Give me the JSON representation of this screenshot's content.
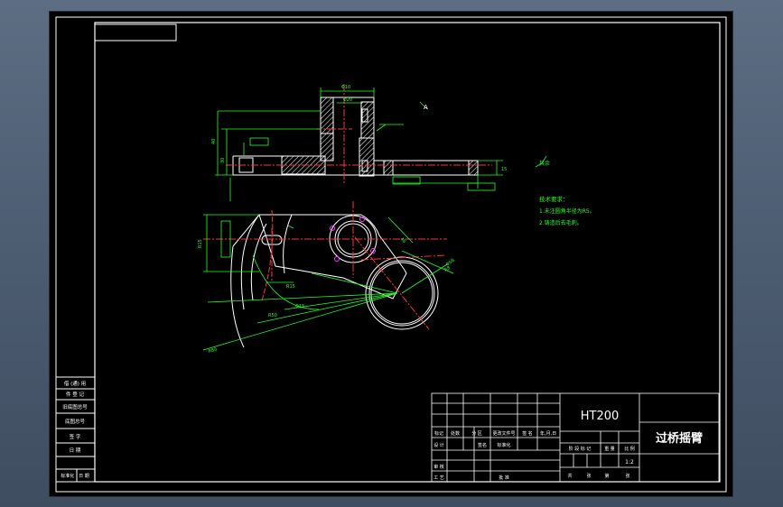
{
  "drawing": {
    "material": "HT200",
    "part_name": "过桥摇臂",
    "scale": "1:2",
    "view_label": "A",
    "roughness_label": "其余"
  },
  "technical_requirements": {
    "heading": "技术要求：",
    "items": [
      "1.未注圆角半径为R5。",
      "2.铸造后去毛刺。"
    ]
  },
  "title_block": {
    "header_row": [
      "标记",
      "处数",
      "分 区",
      "更改文件号",
      "签 名",
      "年,月,日"
    ],
    "design_row": [
      "设 计",
      "签名",
      "标准化"
    ],
    "audit_row": [
      "审 核"
    ],
    "process_row": [
      "工 艺",
      "批 准"
    ],
    "stage_row": [
      "阶 段 标 记",
      "重 量",
      "比 例"
    ],
    "sheets_row": [
      "共",
      "张",
      "第",
      "张"
    ]
  },
  "side_table": {
    "rows": [
      "借 (通) 用",
      "件 登 记",
      "旧底图总号",
      "底图总号",
      "签 字",
      "日 期",
      "标准化 | 日 期"
    ]
  },
  "dimension_labels": [
    "Φ10",
    "Φ20",
    "40",
    "30",
    "15",
    "R15",
    "R15",
    "48",
    "R8",
    "Φ58",
    "R50",
    "Φ15",
    "R80"
  ],
  "colors": {
    "sheet_background": "#000000",
    "outline": "#ffffff",
    "dimension": "#22ff22",
    "centerline": "#ff3333",
    "section_hatch": "#ffffff",
    "magenta_marker": "#ff33ff"
  }
}
